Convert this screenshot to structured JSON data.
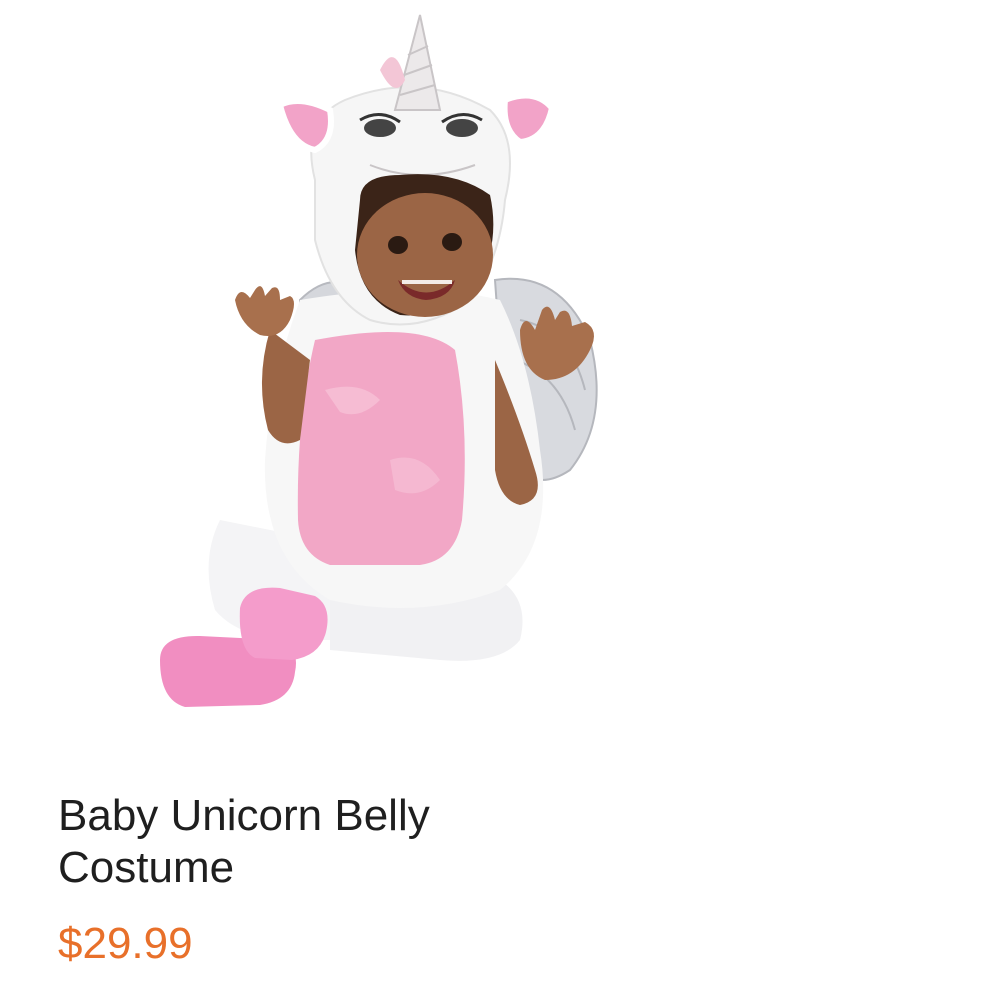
{
  "product": {
    "title_line1": "Baby Unicorn Belly",
    "title_line2": "Costume",
    "price": "$29.99",
    "image_icon": "unicorn-costume-baby-photo"
  },
  "colors": {
    "price": "#e8702a",
    "title": "#1f1f1f",
    "costume_pink": "#f2a7c6",
    "costume_white": "#f6f6f6",
    "wing_silver": "#c9cbd1",
    "skin": "#9b6545",
    "hair": "#3b2418"
  }
}
